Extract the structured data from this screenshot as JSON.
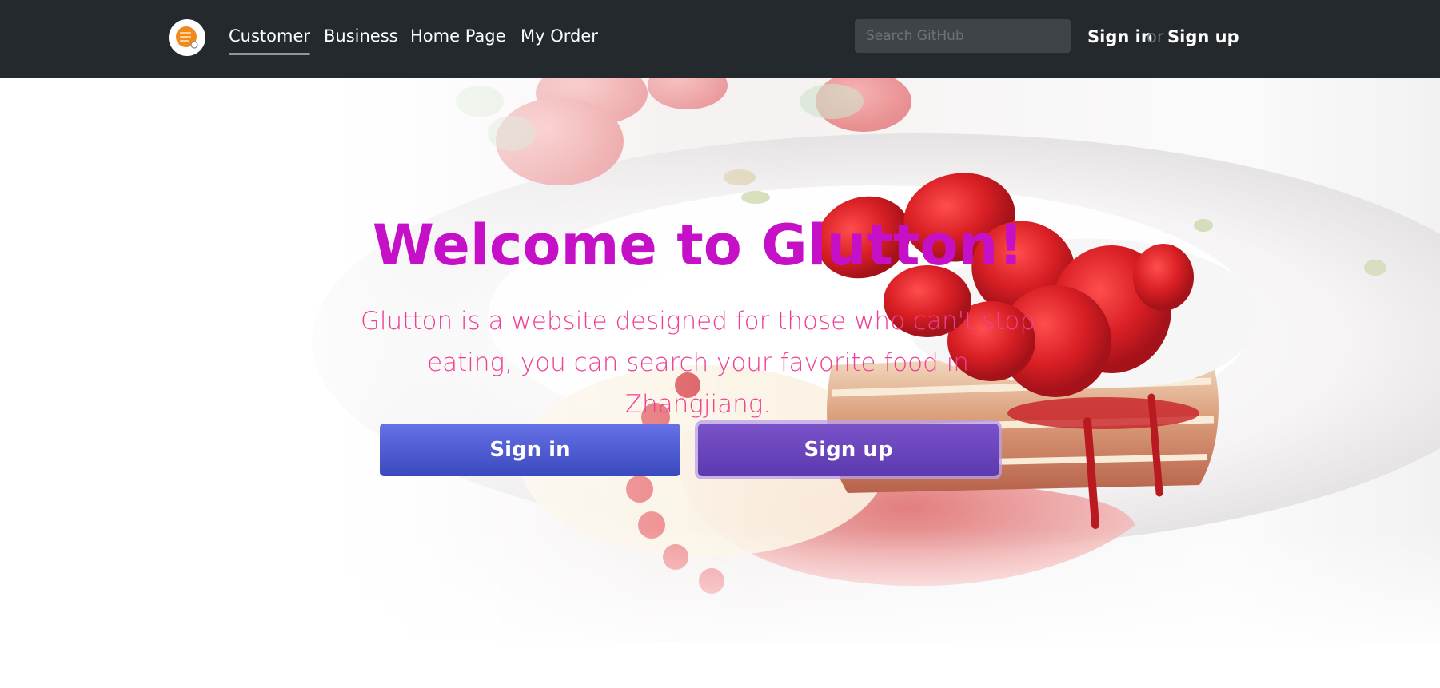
{
  "navbar": {
    "logo_icon": "glutton-logo-icon",
    "items": [
      {
        "label": "Customer",
        "active": true
      },
      {
        "label": "Business",
        "active": false
      },
      {
        "label": "Home Page",
        "active": false
      },
      {
        "label": "My Order",
        "active": false
      }
    ],
    "search": {
      "placeholder": "Search GitHub",
      "value": ""
    },
    "sign_in": "Sign in",
    "or": "or",
    "sign_up": "Sign up"
  },
  "hero": {
    "background_image": "strawberry-pancake-dessert",
    "title": "Welcome to Glutton!",
    "subtitle": "Glutton is a website designed for those who can't stop eating, you can search your favorite food in Zhangjiang.",
    "sign_in_button": "Sign in",
    "sign_up_button": "Sign up"
  },
  "colors": {
    "navbar_bg": "#24292e",
    "title": "#c610c8",
    "subtitle": "#ee3f96",
    "sign_in_button": "#4b59d2",
    "sign_up_button": "#6b44bc"
  }
}
